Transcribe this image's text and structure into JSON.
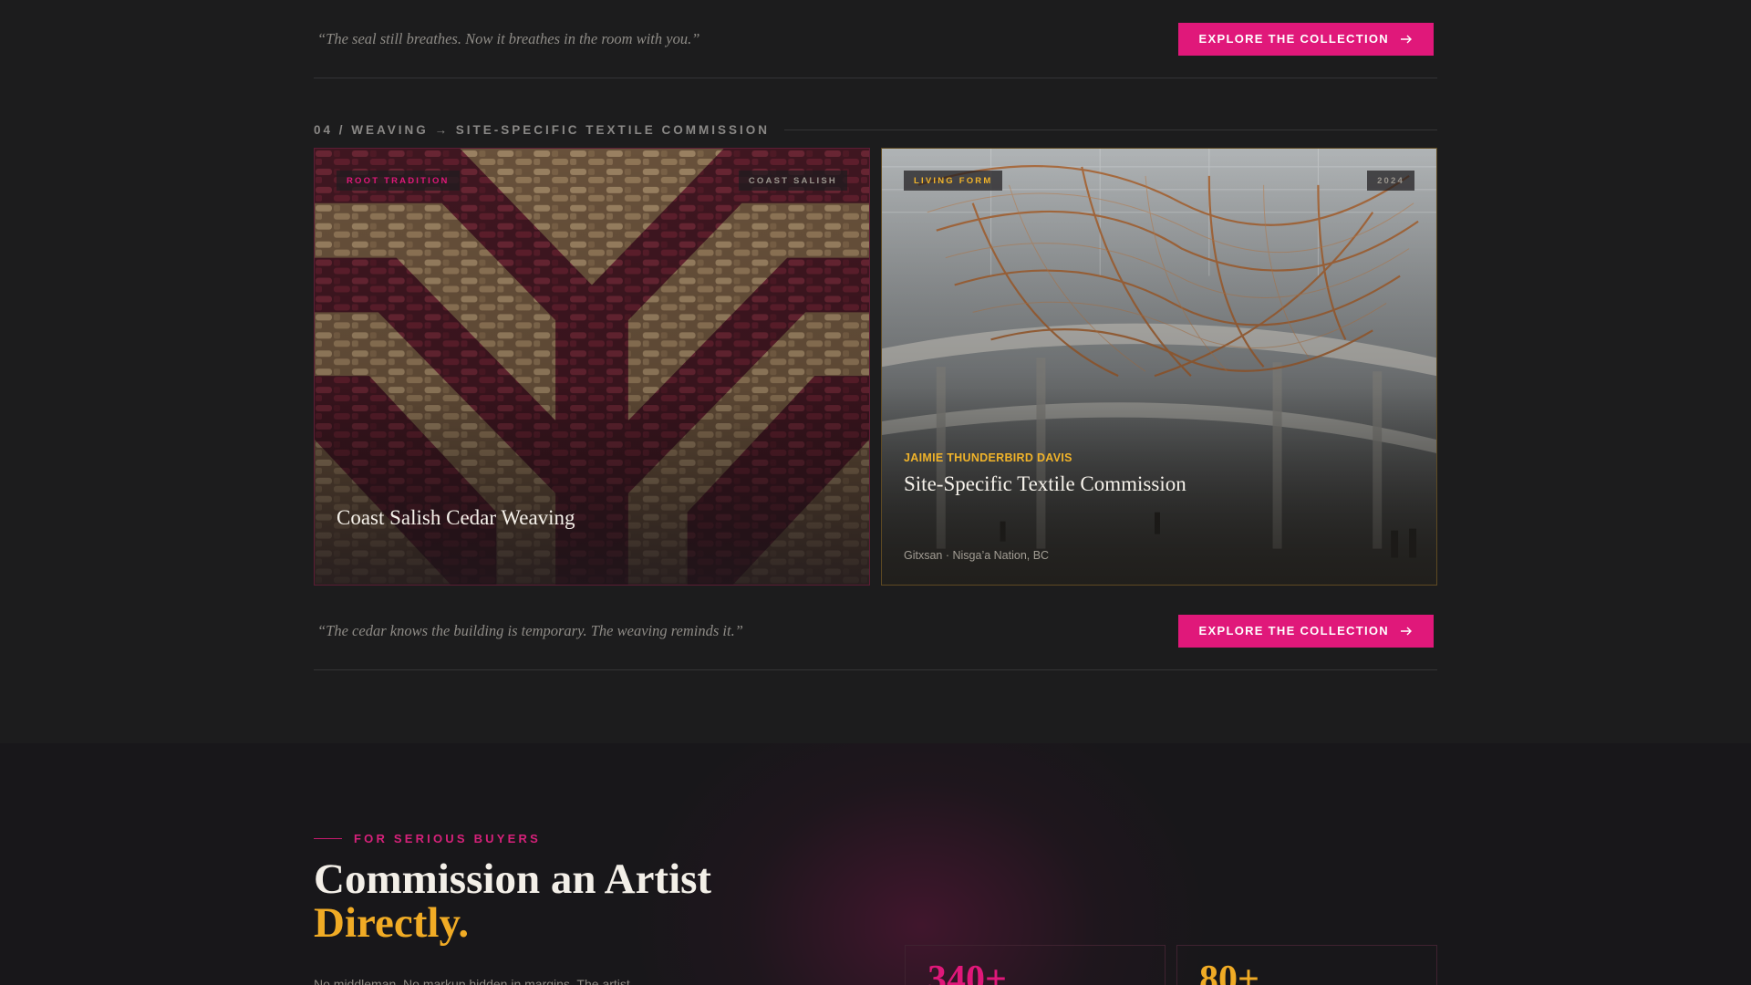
{
  "top_quote": {
    "text": "“The seal still breathes. Now it breathes in the room with you.”",
    "cta_label": "EXPLORE THE COLLECTION"
  },
  "section": {
    "label": "04 / WEAVING → SITE-SPECIFIC TEXTILE COMMISSION"
  },
  "cards": [
    {
      "tag_left": "ROOT TRADITION",
      "tag_right": "COAST SALISH",
      "title": "Coast Salish Cedar Weaving",
      "tag_left_color": "#e0187a"
    },
    {
      "tag_left": "LIVING FORM",
      "tag_right": "2024",
      "artist": "JAIMIE THUNDERBIRD DAVIS",
      "title": "Site-Specific Textile Commission",
      "meta": "Gitxsan · Nisga’a Nation, BC",
      "tag_left_color": "#f0b32a"
    }
  ],
  "bottom_quote": {
    "text": "“The cedar knows the building is temporary. The weaving reminds it.”",
    "cta_label": "EXPLORE THE COLLECTION"
  },
  "commission": {
    "eyebrow": "FOR SERIOUS BUYERS",
    "headline_line1": "Commission an Artist",
    "headline_line2": "Directly.",
    "body_partial": "No middleman. No markup hidden in margins. The artist",
    "stats": [
      {
        "number": "340+",
        "color": "#e0187a"
      },
      {
        "number": "80+",
        "color": "#f0ab25"
      }
    ]
  },
  "colors": {
    "brand_pink": "#e0187a",
    "gold": "#f0b32a",
    "background": "#1c1c1d"
  },
  "icons": {
    "cta_arrow": "arrow-right-icon"
  }
}
